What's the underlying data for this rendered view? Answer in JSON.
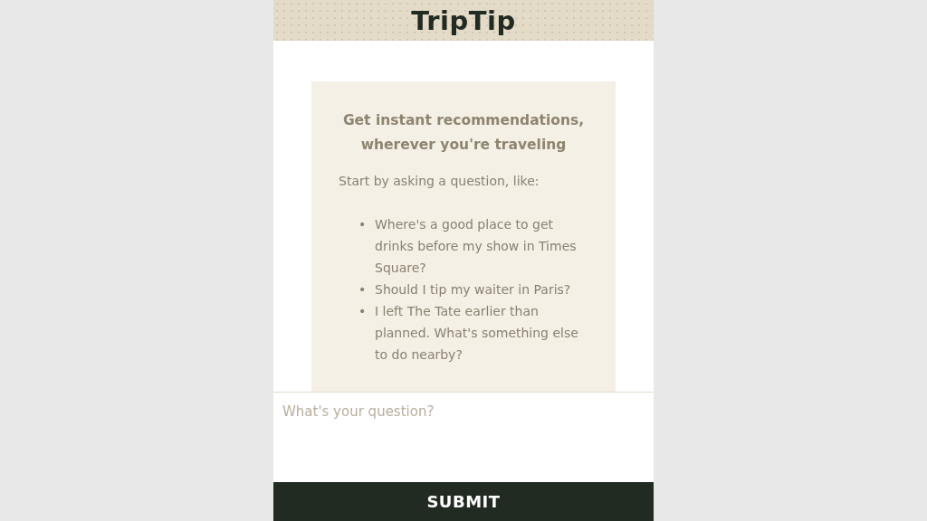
{
  "header": {
    "title": "TripTip"
  },
  "intro": {
    "heading": "Get instant recommendations, wherever you're traveling",
    "lead": "Start by asking a question, like:",
    "examples": [
      {
        "marker": "•",
        "text": "Where's a good place to get drinks before my show in Times Square?"
      },
      {
        "marker": "•",
        "text": "Should I tip my waiter in Paris?"
      },
      {
        "marker": "•",
        "text": "I left The Tate earlier than planned. What's something else to do nearby?"
      }
    ]
  },
  "question": {
    "placeholder": "What's your question?"
  },
  "submit": {
    "label": "SUBMIT"
  }
}
